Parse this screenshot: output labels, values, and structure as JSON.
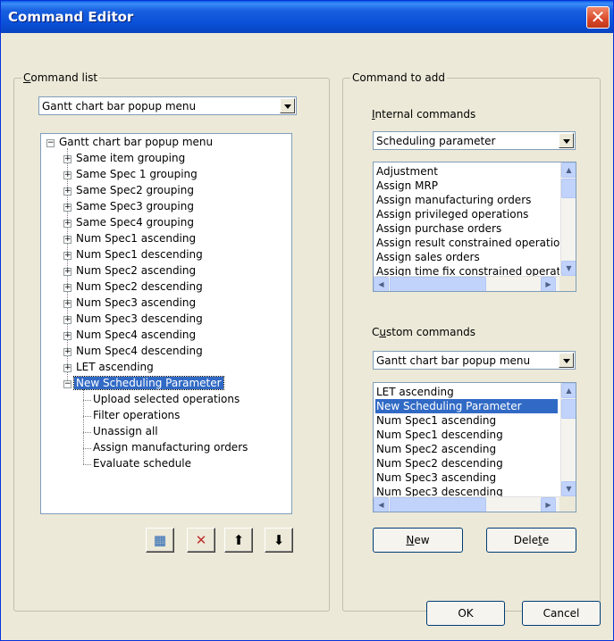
{
  "window": {
    "title": "Command Editor",
    "close_glyph": "✕"
  },
  "command_list": {
    "group_label_hotkey": "C",
    "group_label_rest": "ommand list",
    "combo_value": "Gantt chart bar popup menu",
    "tree": {
      "root": "Gantt chart bar popup menu",
      "children": [
        "Same item grouping",
        "Same Spec 1 grouping",
        "Same Spec2 grouping",
        "Same Spec3 grouping",
        "Same Spec4 grouping",
        "Num Spec1 ascending",
        "Num Spec1 descending",
        "Num Spec2 ascending",
        "Num Spec2 descending",
        "Num Spec3 ascending",
        "Num Spec3 descending",
        "Num Spec4 ascending",
        "Num Spec4 descending",
        "LET ascending",
        "New Scheduling Parameter"
      ],
      "selected": "New Scheduling Parameter",
      "subchildren": [
        "Upload selected operations",
        "Filter operations",
        "Unassign all",
        "Assign manufacturing orders",
        "Evaluate schedule"
      ]
    },
    "toolbar_icons": [
      "add-command-icon",
      "delete-icon",
      "move-up-icon",
      "move-down-icon"
    ],
    "toolbar_glyphs": [
      "▦",
      "✕",
      "⬆",
      "⬇"
    ]
  },
  "command_to_add": {
    "group_label": "Command to add",
    "internal_label_hotkey": "I",
    "internal_label_rest": "nternal commands",
    "internal_combo_value": "Scheduling parameter",
    "internal_list": [
      "Adjustment",
      "Assign MRP",
      "Assign manufacturing orders",
      "Assign privileged operations",
      "Assign purchase orders",
      "Assign result constrained operations",
      "Assign sales orders",
      "Assign time fix constrained operations"
    ],
    "custom_label_pre": "C",
    "custom_label_hotkey": "u",
    "custom_label_rest": "stom commands",
    "custom_combo_value": "Gantt chart bar popup menu",
    "custom_list": [
      "LET ascending",
      "New Scheduling Parameter",
      "Num Spec1 ascending",
      "Num Spec1 descending",
      "Num Spec2 ascending",
      "Num Spec2 descending",
      "Num Spec3 ascending",
      "Num Spec3 descending"
    ],
    "custom_selected_index": 1,
    "new_button_hotkey": "N",
    "new_button_rest": "ew",
    "delete_button_pre": "Dele",
    "delete_button_hotkey": "t",
    "delete_button_rest": "e"
  },
  "footer": {
    "ok_label": "OK",
    "cancel_label": "Cancel"
  },
  "colors": {
    "selection": "#316ac5",
    "title_bar": "#0a50d8",
    "dialog_bg": "#ece9d8"
  }
}
